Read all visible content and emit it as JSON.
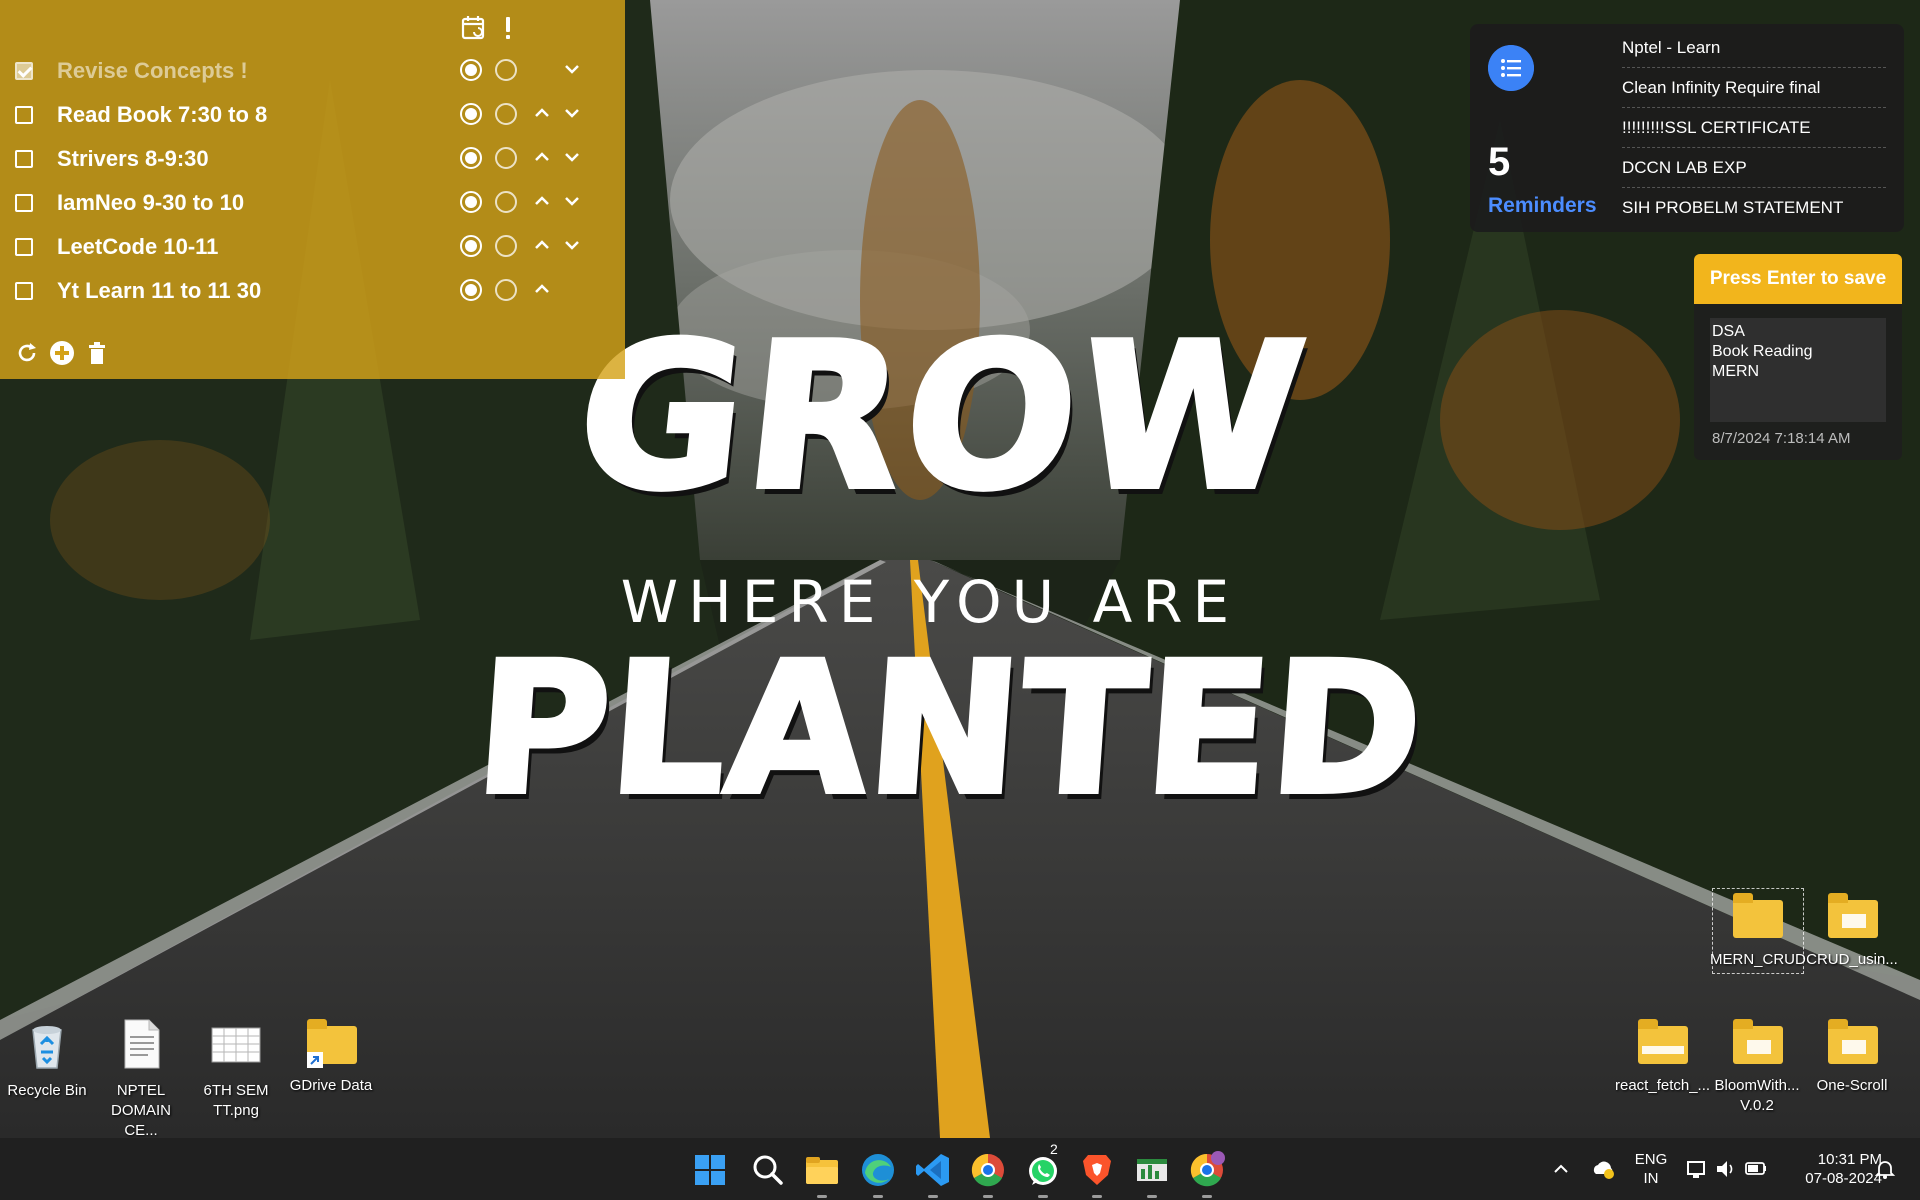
{
  "wallpaper": {
    "line1": "GROW",
    "line2": "WHERE YOU ARE",
    "line3": "PLANTED"
  },
  "todo": {
    "items": [
      {
        "label": "Revise Concepts !",
        "done": true
      },
      {
        "label": "Read Book 7:30 to 8",
        "done": false
      },
      {
        "label": "Strivers 8-9:30",
        "done": false
      },
      {
        "label": "IamNeo 9-30 to 10",
        "done": false
      },
      {
        "label": "LeetCode 10-11",
        "done": false
      },
      {
        "label": "Yt Learn 11 to 11 30",
        "done": false
      }
    ],
    "top_icons": [
      "calendar-icon",
      "exclamation-icon"
    ],
    "bottom_icons": [
      "refresh-icon",
      "add-icon",
      "delete-icon"
    ]
  },
  "reminders": {
    "count": "5",
    "label": "Reminders",
    "items": [
      "Nptel  - Learn",
      "Clean Infinity Require final",
      "!!!!!!!!!SSL CERTIFICATE",
      "DCCN LAB EXP",
      "SIH PROBELM STATEMENT"
    ]
  },
  "sticky": {
    "header": "Press Enter to save",
    "lines": [
      "DSA",
      "Book Reading",
      "MERN"
    ],
    "date": "8/7/2024 7:18:14 AM"
  },
  "desktop_icons": {
    "left": [
      {
        "label": "Recycle Bin",
        "icon": "recycle-bin-icon"
      },
      {
        "label": "NPTEL DOMAIN CE...",
        "icon": "document-icon"
      },
      {
        "label": "6TH SEM TT.png",
        "icon": "image-file-icon"
      },
      {
        "label": "GDrive Data",
        "icon": "folder-shortcut-icon"
      }
    ],
    "right_top": [
      {
        "label": "MERN_CRUD",
        "icon": "folder-icon"
      },
      {
        "label": "CRUD_usin...",
        "icon": "folder-icon"
      }
    ],
    "right_bottom": [
      {
        "label": "react_fetch_...",
        "icon": "folder-icon"
      },
      {
        "label": "BloomWith... V.0.2",
        "icon": "folder-icon"
      },
      {
        "label": "One-Scroll",
        "icon": "folder-icon"
      }
    ]
  },
  "taskbar": {
    "apps": [
      "start-icon",
      "search-icon",
      "file-explorer-icon",
      "edge-icon",
      "vscode-icon",
      "chrome-icon",
      "whatsapp-icon",
      "brave-icon",
      "sticky-notes-icon",
      "chrome-profile-icon"
    ],
    "whatsapp_badge": "2",
    "lang_line1": "ENG",
    "lang_line2": "IN",
    "time": "10:31 PM",
    "date": "07-08-2024"
  },
  "colors": {
    "todo_panel": "#d4a218",
    "reminder_accent": "#3b82f6",
    "sticky_header": "#f2b51c",
    "taskbar": "#202020"
  }
}
